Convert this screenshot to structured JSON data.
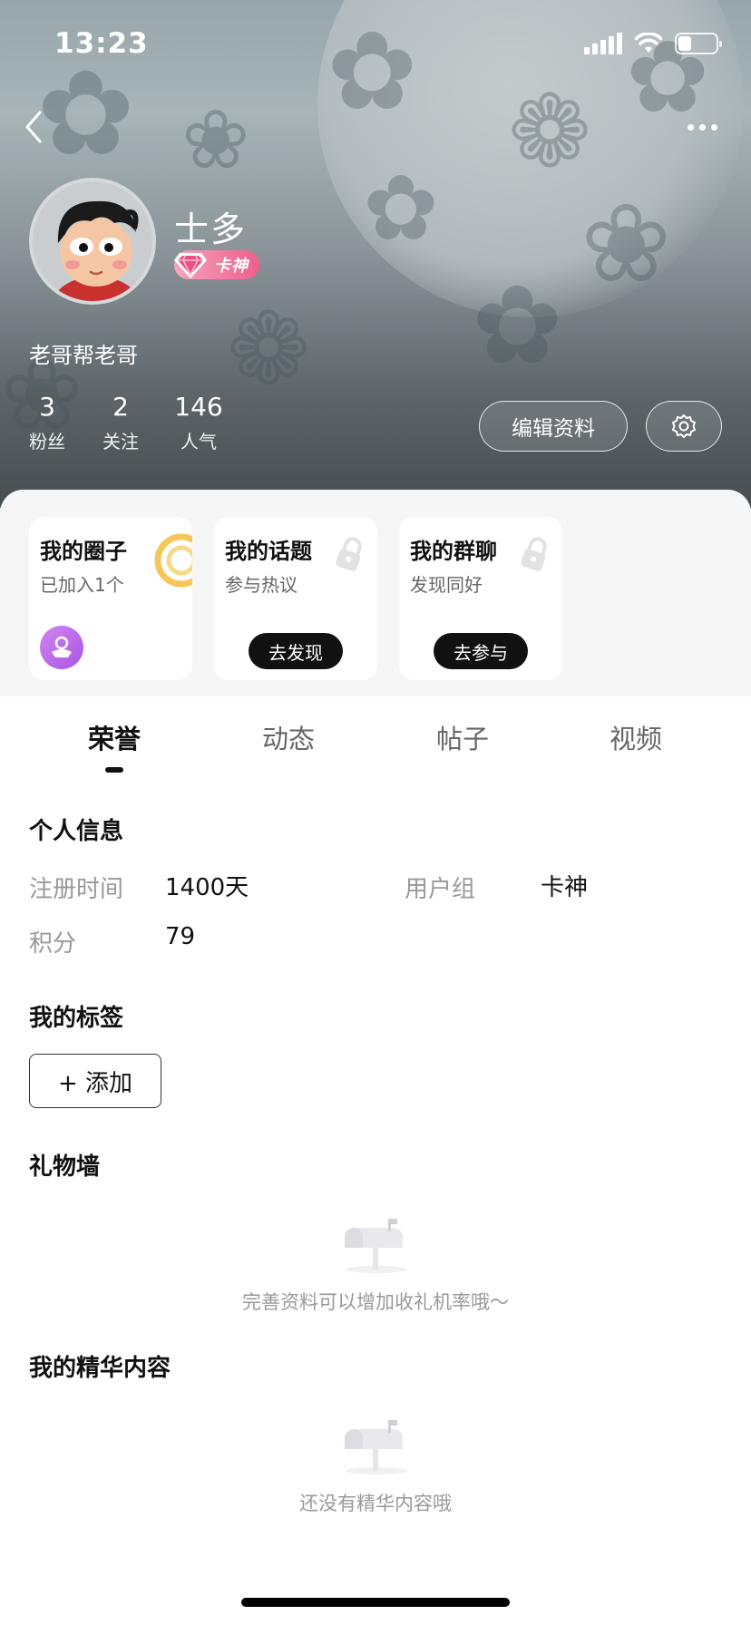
{
  "status_bar": {
    "time": "13:23"
  },
  "profile": {
    "username": "士多",
    "badge_label": "卡神",
    "bio": "老哥帮老哥",
    "stats": [
      {
        "value": "3",
        "label": "粉丝"
      },
      {
        "value": "2",
        "label": "关注"
      },
      {
        "value": "146",
        "label": "人气"
      }
    ],
    "edit_button": "编辑资料"
  },
  "cards": [
    {
      "title": "我的圈子",
      "subtitle": "已加入1个"
    },
    {
      "title": "我的话题",
      "subtitle": "参与热议",
      "button": "去发现"
    },
    {
      "title": "我的群聊",
      "subtitle": "发现同好",
      "button": "去参与"
    }
  ],
  "tabs": [
    "荣誉",
    "动态",
    "帖子",
    "视频"
  ],
  "active_tab": "荣誉",
  "personal_info": {
    "title": "个人信息",
    "register_label": "注册时间",
    "register_value": "1400天",
    "group_label": "用户组",
    "group_value": "卡神",
    "points_label": "积分",
    "points_value": "79"
  },
  "tags": {
    "title": "我的标签",
    "add_button": "+ 添加"
  },
  "gift_wall": {
    "title": "礼物墙",
    "empty_text": "完善资料可以增加收礼机率哦～"
  },
  "featured": {
    "title": "我的精华内容",
    "empty_text": "还没有精华内容哦"
  },
  "colors": {
    "badge_pink": "#ee5f8b",
    "accent_purple": "#a955e3",
    "ring_gold": "#f5c75a"
  }
}
